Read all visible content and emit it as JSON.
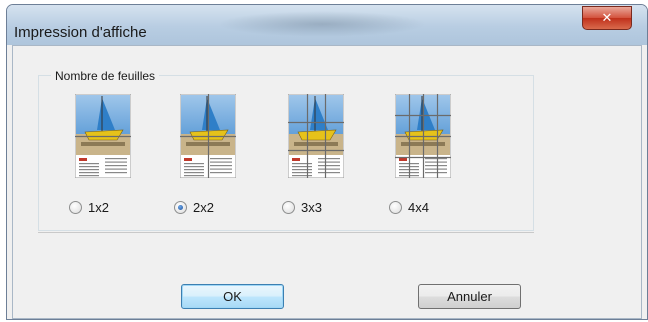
{
  "window": {
    "title": "Impression d'affiche",
    "close_icon": "close-icon"
  },
  "group": {
    "legend": "Nombre de feuilles",
    "options": [
      {
        "label": "1x2",
        "checked": false,
        "cols": 1,
        "rows": 2
      },
      {
        "label": "2x2",
        "checked": true,
        "cols": 2,
        "rows": 2
      },
      {
        "label": "3x3",
        "checked": false,
        "cols": 3,
        "rows": 3
      },
      {
        "label": "4x4",
        "checked": false,
        "cols": 4,
        "rows": 4
      }
    ]
  },
  "buttons": {
    "ok": "OK",
    "cancel": "Annuler"
  },
  "colors": {
    "sky": "#5a9ad6",
    "boat": "#e6c21a",
    "sail": "#2f7fc8",
    "sand": "#c9b48a",
    "accent": "#3c7fb1"
  }
}
